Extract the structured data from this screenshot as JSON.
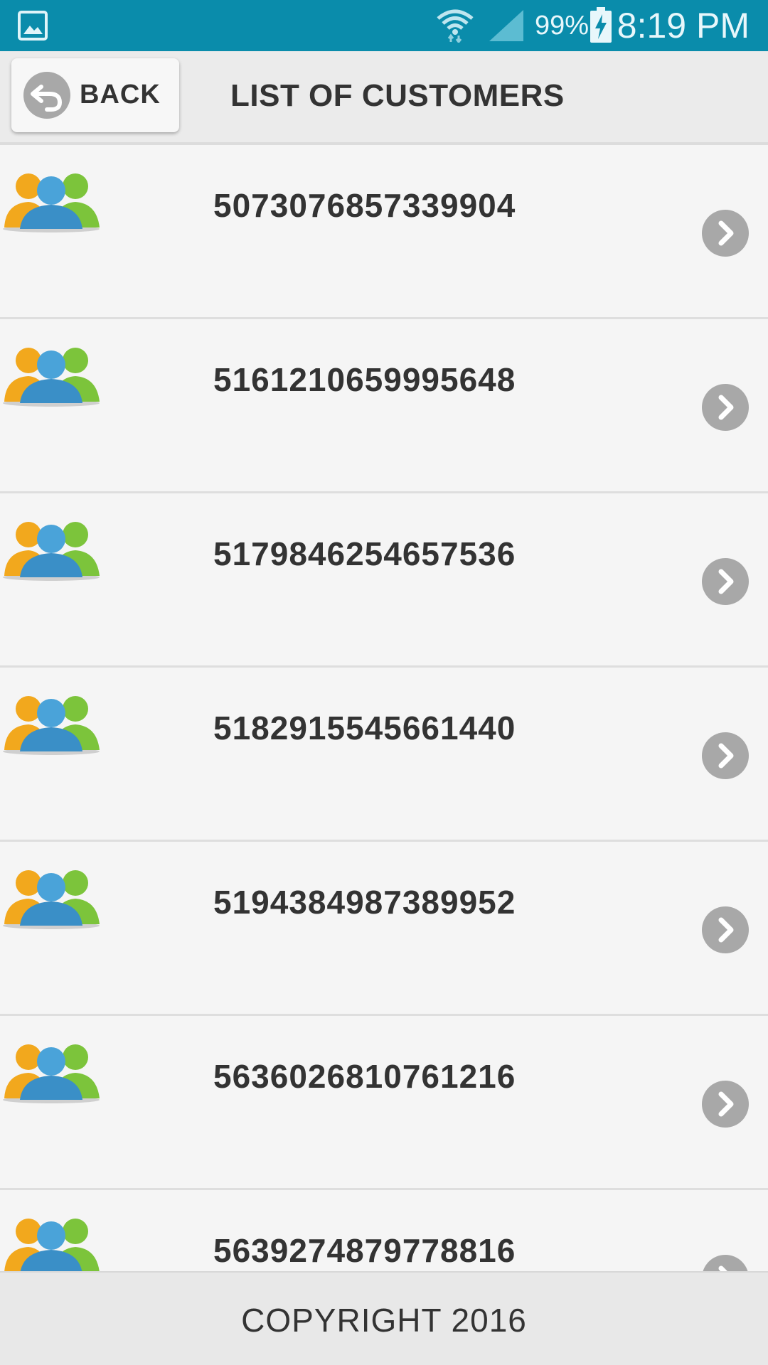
{
  "status_bar": {
    "battery_percent": "99%",
    "time": "8:19 PM",
    "icons": [
      "gallery-icon",
      "wifi-icon",
      "signal-icon",
      "battery-charging-icon"
    ]
  },
  "header": {
    "back_label": "BACK",
    "title": "LIST OF CUSTOMERS"
  },
  "customers": [
    {
      "id": "5073076857339904"
    },
    {
      "id": "5161210659995648"
    },
    {
      "id": "5179846254657536"
    },
    {
      "id": "5182915545661440"
    },
    {
      "id": "5194384987389952"
    },
    {
      "id": "5636026810761216"
    },
    {
      "id": "5639274879778816"
    }
  ],
  "footer": {
    "copyright": "COPYRIGHT 2016"
  },
  "colors": {
    "status_bar": "#0a8cab",
    "header": "#ebebeb",
    "list_bg": "#f5f5f5",
    "chevron": "#a8a8a8",
    "text": "#333333"
  }
}
